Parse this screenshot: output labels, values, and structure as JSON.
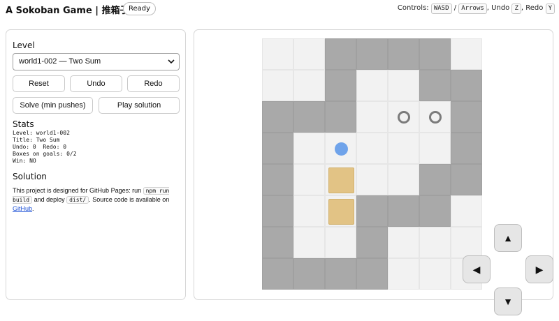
{
  "header": {
    "title": "A Sokoban Game | 推箱子游戏",
    "status": "Ready",
    "controls": {
      "label": "Controls:",
      "move_keys": [
        "WASD",
        "Arrows"
      ],
      "separator": "/",
      "undo_label": "Undo",
      "undo_key": "Z",
      "redo_label": "Redo",
      "redo_key": "Y"
    }
  },
  "sidebar": {
    "level_heading": "Level",
    "level_select": "world1-002 — Two Sum",
    "buttons": {
      "reset": "Reset",
      "undo": "Undo",
      "redo": "Redo",
      "solve": "Solve (min pushes)",
      "play": "Play solution"
    },
    "stats_heading": "Stats",
    "stats": {
      "level": "Level: world1-002",
      "title": "Title: Two Sum",
      "undo_redo": "Undo: 0  Redo: 0",
      "boxes": "Boxes on goals: 0/2",
      "win": "Win: NO"
    },
    "solution_heading": "Solution",
    "solution": {
      "part1": "This project is designed for GitHub Pages: run ",
      "code1": "npm run build",
      "part2": " and deploy ",
      "code2": "dist/",
      "part3": ". Source code is available on ",
      "link": "GitHub",
      "part4": "."
    }
  },
  "board": {
    "map": [
      "..WWWW.",
      "..W..WW",
      "WWW.GGW",
      "W.P...W",
      "W.B..WW",
      "W.BWWW.",
      "W..W...",
      "WWWW..."
    ]
  },
  "dpad": {
    "up": "▲",
    "left": "◀",
    "right": "▶",
    "down": "▼"
  }
}
